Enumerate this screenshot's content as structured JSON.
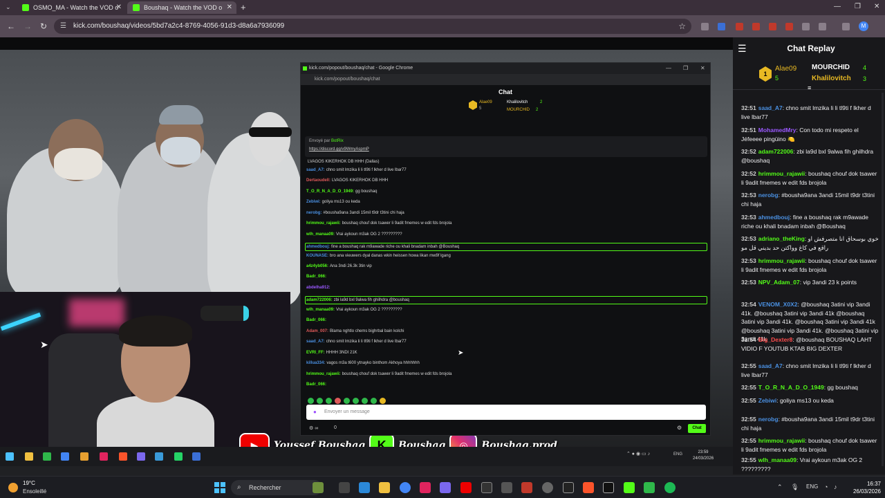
{
  "browser": {
    "tabs": [
      {
        "title": "OSMO_MA - Watch the VOD o"
      },
      {
        "title": "Boushaq - Watch the VOD o"
      }
    ],
    "url": "kick.com/boushaq/videos/5bd7a2c4-8769-4056-91d3-d8a6a7936099"
  },
  "popout": {
    "window_title": "kick.com/popout/boushaq/chat - Google Chrome",
    "url": "kick.com/popout/boushaq/chat",
    "header": "Chat",
    "top_gifters": [
      {
        "name": "Alae09",
        "count": "5"
      },
      {
        "name": "Khalilovitch",
        "count": "2"
      },
      {
        "name": "MOURCHID",
        "count": "2"
      }
    ],
    "pinned": {
      "label": "Envoyé par",
      "sender": "BotRix",
      "link": "https://discord.gg/v9WmyAspmP"
    },
    "messages": [
      {
        "user": "",
        "text": "LVAGOS KIKERHOK DB HHH (Dallas)"
      },
      {
        "user": "saad_A7:",
        "text": "chno smit lmzika li li tl9ti f lkher d live lbar77"
      },
      {
        "user": "Dertaoudell:",
        "text": "LVAGOS KIKERHOK DB HHH"
      },
      {
        "user": "T_O_R_N_A_D_O_1949:",
        "text": "gg boushaq"
      },
      {
        "user": "Zebiwi:",
        "text": "goliya ms13 ou keda"
      },
      {
        "user": "nerobg:",
        "text": "#bousha9ana 3andi 15mil t9dr t3tini chi haja"
      },
      {
        "user": "hrimmou_rajawii:",
        "text": "boushaq chouf dok tsawer li 9adit fmemes w edit fds brojola"
      },
      {
        "user": "wlh_manaa09:",
        "text": "Vrai aykoun m3ak OG 2 ?????????"
      },
      {
        "user": "ahmedbouj:",
        "text": "fine a boushaq rak m9awade riche ou khali bnadam inbah @Boushaq"
      },
      {
        "user": "KOUNASE:",
        "text": "bro ana vieuwers dyal danas wkin heissen howa likan mw9f lgang"
      },
      {
        "user": "a4z4yb056:",
        "text": "Ana 3ndi 26.3k 3tin vip"
      },
      {
        "user": "Badr_066:",
        "text": ""
      },
      {
        "user": "abdelha912:",
        "text": ""
      },
      {
        "user": "adam722006:",
        "text": "zbi la9d bxl 9alwa fih ghilhdra @boushaq"
      },
      {
        "user": "wlh_manaa09:",
        "text": "Vrai aykoun m3ak OG 2 ?????????"
      },
      {
        "user": "Badr_066:",
        "text": ""
      },
      {
        "user": "Adam_007:",
        "text": "Blama nghtlo chems bighrbal bain kolchi"
      },
      {
        "user": "saad_A7:",
        "text": "chno smit lmzika li li tl9ti f lkher d live lbar77"
      },
      {
        "user": "EVRI_FF:",
        "text": "HHHH 3NDI 21K"
      },
      {
        "user": "killua334:",
        "text": "vagos m3a t600 ytnayko binthom Akhoya hhhhhhh"
      },
      {
        "user": "hrimmou_rajawii:",
        "text": "boushaq chouf dok tsawer li 9adit fmemes w edit fds brojola"
      },
      {
        "user": "Badr_066:",
        "text": ""
      }
    ],
    "input_placeholder": "Envoyer un message",
    "count": "0",
    "chat_button": "Chat"
  },
  "overlay": {
    "youtube": "Youssef Boushaq",
    "kick": "Boushaq",
    "instagram": "Boushaq.prod"
  },
  "inner_clock": {
    "time": "23:59",
    "date": "24/03/2026",
    "lang": "ENG"
  },
  "chat_replay": {
    "title": "Chat Replay",
    "top": [
      {
        "name": "Alae09",
        "count": "5",
        "badge": "1"
      },
      {
        "name": "MOURCHID",
        "count": "4"
      },
      {
        "name": "Khalilovitch",
        "count": "3"
      }
    ],
    "messages": [
      {
        "time": "32:51",
        "user": "saad_A7",
        "color": "#4a90e2",
        "text": "chno smit lmzika li li tl9ti f lkher d live lbar77"
      },
      {
        "time": "32:51",
        "user": "MohamedMry",
        "color": "#9b59ff",
        "text": "Con todo mi respeto el Jéfeeee pingüino 🍋"
      },
      {
        "time": "32:52",
        "user": "adam722006",
        "color": "#53fc18",
        "text": "zbi la9d bxl 9alwa fih ghilhdra @boushaq"
      },
      {
        "time": "32:52",
        "user": "hrimmou_rajawii",
        "color": "#53fc18",
        "text": "boushaq chouf dok tsawer li 9adit fmemes w edit fds brojola"
      },
      {
        "time": "32:53",
        "user": "nerobg",
        "color": "#4a90e2",
        "text": "#bousha9ana 3andi 15mil t9dr t3tini chi haja"
      },
      {
        "time": "32:53",
        "user": "ahmedbouj",
        "color": "#4a90e2",
        "text": "fine a boushaq rak m9awade riche ou khali bnadam inbah @Boushaq"
      },
      {
        "time": "32:53",
        "user": "adriano_theKing",
        "color": "#53fc18",
        "text": "خوي بوسحاق انا متصرفش او راقع في كاغ وواكتن حد بديني قل مو"
      },
      {
        "time": "32:53",
        "user": "hrimmou_rajawii",
        "color": "#53fc18",
        "text": "boushaq chouf dok tsawer li 9adit fmemes w edit fds brojola"
      },
      {
        "time": "32:53",
        "user": "NPV_Adam_07",
        "color": "#53fc18",
        "text": "vip 3andi 23 k points"
      },
      {
        "time": "32:54",
        "user": "VENOM_X0X2",
        "color": "#4a90e2",
        "text": "@boushaq 3atini vip 3andi 41k. @boushaq 3atini vip 3andi 41k @boushaq 3atini vip 3andi 41k. @boushaq 3atini vip 3andi 41k @boushaq 3atini vip 3andi 41k. @boushaq 3atini vip 3andi 41k"
      },
      {
        "time": "32:54",
        "user": "Big_Dexter8",
        "color": "#ff4d4d",
        "text": "@boushaq BOUSHAQ LAHT VIDIO F YOUTUB KTAB BIG DEXTER"
      },
      {
        "time": "32:55",
        "user": "saad_A7",
        "color": "#4a90e2",
        "text": "chno smit lmzika li li tl9ti f lkher d live lbar77"
      },
      {
        "time": "32:55",
        "user": "T_O_R_N_A_D_O_1949",
        "color": "#53fc18",
        "text": "gg boushaq"
      },
      {
        "time": "32:55",
        "user": "Zebiwi",
        "color": "#4a90e2",
        "text": "goliya ms13 ou keda"
      },
      {
        "time": "32:55",
        "user": "nerobg",
        "color": "#4a90e2",
        "text": "#bousha9ana 3andi 15mil t9dr t3tini chi haja"
      },
      {
        "time": "32:55",
        "user": "hrimmou_rajawii",
        "color": "#53fc18",
        "text": "boushaq chouf dok tsawer li 9adit fmemes w edit fds brojola"
      },
      {
        "time": "32:55",
        "user": "wlh_manaa09",
        "color": "#53fc18",
        "text": "Vrai aykoun m3ak OG 2 ?????????"
      }
    ]
  },
  "taskbar": {
    "temp": "19°C",
    "weather": "Ensoleillé",
    "search": "Rechercher",
    "lang": "ENG",
    "time": "16:37",
    "date": "26/03/2026"
  },
  "colors": {
    "kick_green": "#53fc18",
    "gold": "#e8b923"
  }
}
